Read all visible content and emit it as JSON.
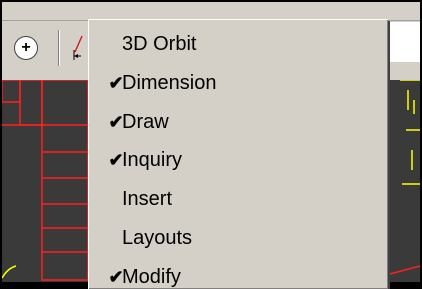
{
  "toolbar": {
    "orbit_button_symbol": "+",
    "orbit_button_icon": "zoom-plus-icon",
    "dimension_tool_icon": "dimension-icon"
  },
  "menu": {
    "items": [
      {
        "label": "3D Orbit",
        "checked": false,
        "check": ""
      },
      {
        "label": "Dimension",
        "checked": true,
        "check": "✔"
      },
      {
        "label": "Draw",
        "checked": true,
        "check": "✔"
      },
      {
        "label": "Inquiry",
        "checked": true,
        "check": "✔"
      },
      {
        "label": "Insert",
        "checked": false,
        "check": ""
      },
      {
        "label": "Layouts",
        "checked": false,
        "check": ""
      },
      {
        "label": "Modify",
        "checked": true,
        "check": "✔"
      }
    ]
  },
  "colors": {
    "menu_bg": "#d4d0c8",
    "drawing_bg": "#3a3a3a",
    "drawing_lines": "#ff2020",
    "highlight_lines": "#ffff00"
  }
}
